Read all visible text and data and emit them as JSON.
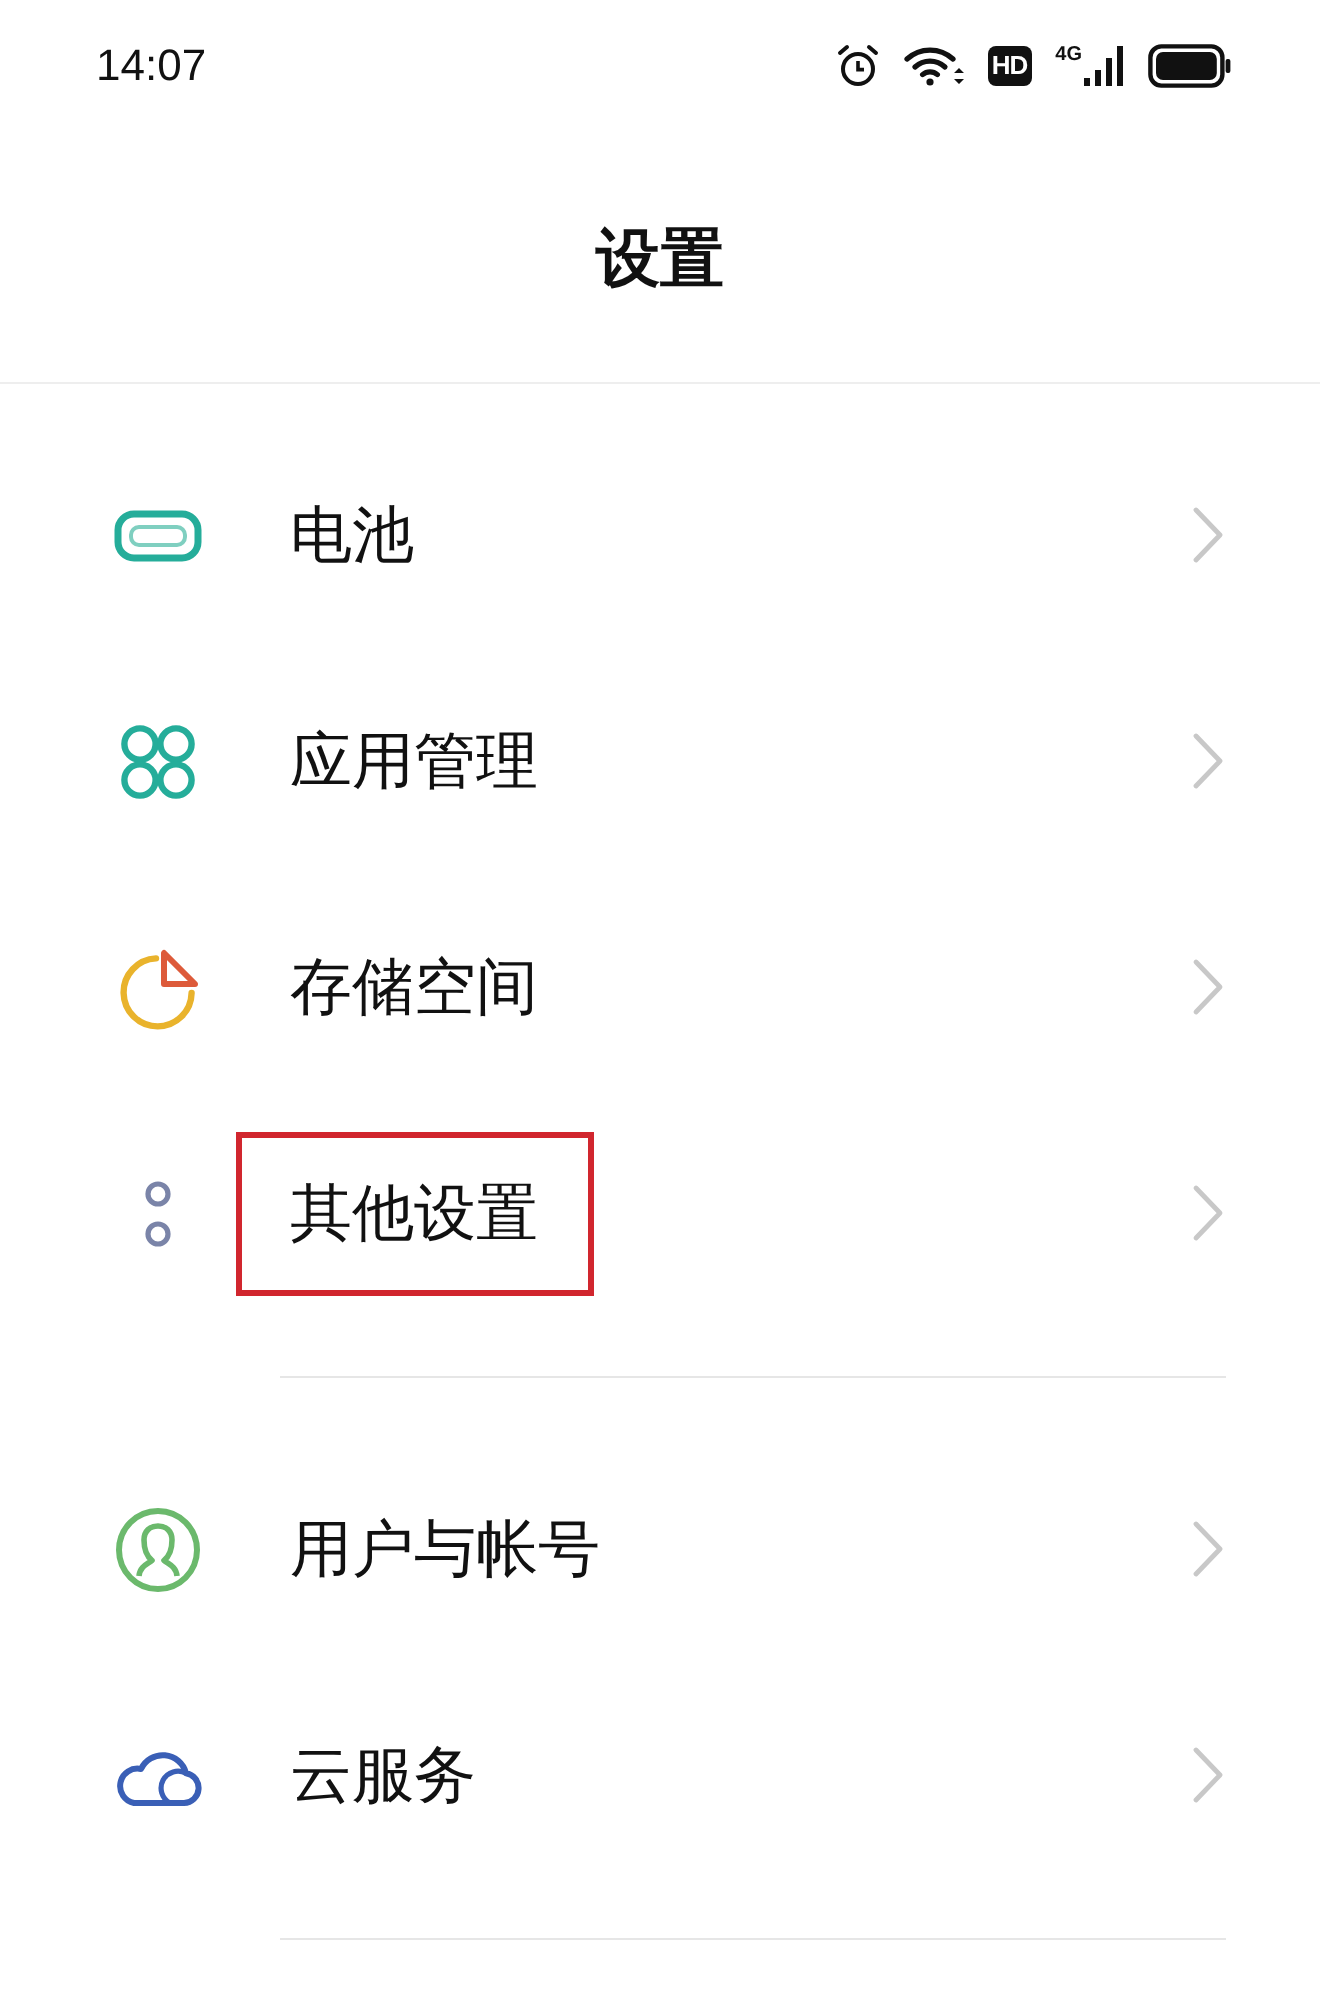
{
  "status_bar": {
    "time": "14:07",
    "hd_label": "HD",
    "network_label": "4G"
  },
  "header": {
    "title": "设置"
  },
  "groups": [
    {
      "items": [
        {
          "kind": "battery",
          "label": "电池",
          "highlighted": false
        },
        {
          "kind": "apps",
          "label": "应用管理",
          "highlighted": false
        },
        {
          "kind": "storage",
          "label": "存储空间",
          "highlighted": false
        },
        {
          "kind": "more",
          "label": "其他设置",
          "highlighted": true
        }
      ]
    },
    {
      "items": [
        {
          "kind": "account",
          "label": "用户与帐号",
          "highlighted": false
        },
        {
          "kind": "cloud",
          "label": "云服务",
          "highlighted": false
        }
      ]
    }
  ]
}
